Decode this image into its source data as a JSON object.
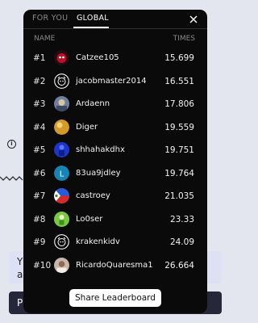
{
  "tabs": {
    "for_you": "FOR YOU",
    "global": "GLOBAL"
  },
  "columns": {
    "name": "NAME",
    "times": "TIMES"
  },
  "rows": [
    {
      "rank": "#1",
      "name": "Catzee105",
      "time": "15.699",
      "avatar": "red-creature",
      "color": "#b3122a"
    },
    {
      "rank": "#2",
      "name": "jacobmaster2014",
      "time": "16.551",
      "avatar": "mascot-outline",
      "color": "#ffffff"
    },
    {
      "rank": "#3",
      "name": "Ardaenn",
      "time": "17.806",
      "avatar": "blue-photo",
      "color": "#6f7fa0"
    },
    {
      "rank": "#4",
      "name": "Diger",
      "time": "19.559",
      "avatar": "gold-orb",
      "color": "#d49b2a"
    },
    {
      "rank": "#5",
      "name": "shhahakdhx",
      "time": "19.751",
      "avatar": "blue-figure",
      "color": "#1e35c9"
    },
    {
      "rank": "#6",
      "name": "83ua9jdley",
      "time": "19.764",
      "avatar": "letter-L",
      "letter": "L",
      "color": "#1685b3"
    },
    {
      "rank": "#7",
      "name": "castroey",
      "time": "21.035",
      "avatar": "flag",
      "color": "#2a5bd6"
    },
    {
      "rank": "#8",
      "name": "Lo0ser",
      "time": "23.33",
      "avatar": "green-figure",
      "color": "#7ac943"
    },
    {
      "rank": "#9",
      "name": "krakenkidv",
      "time": "24.09",
      "avatar": "mascot-outline",
      "color": "#ffffff"
    },
    {
      "rank": "#10",
      "name": "RicardoQuaresma1",
      "time": "26.664",
      "avatar": "portrait",
      "color": "#c9b6a8"
    }
  ],
  "share_label": "Share Leaderboard",
  "background": {
    "card_line1": "Y",
    "card_line2": "a",
    "bar_label": "P"
  }
}
